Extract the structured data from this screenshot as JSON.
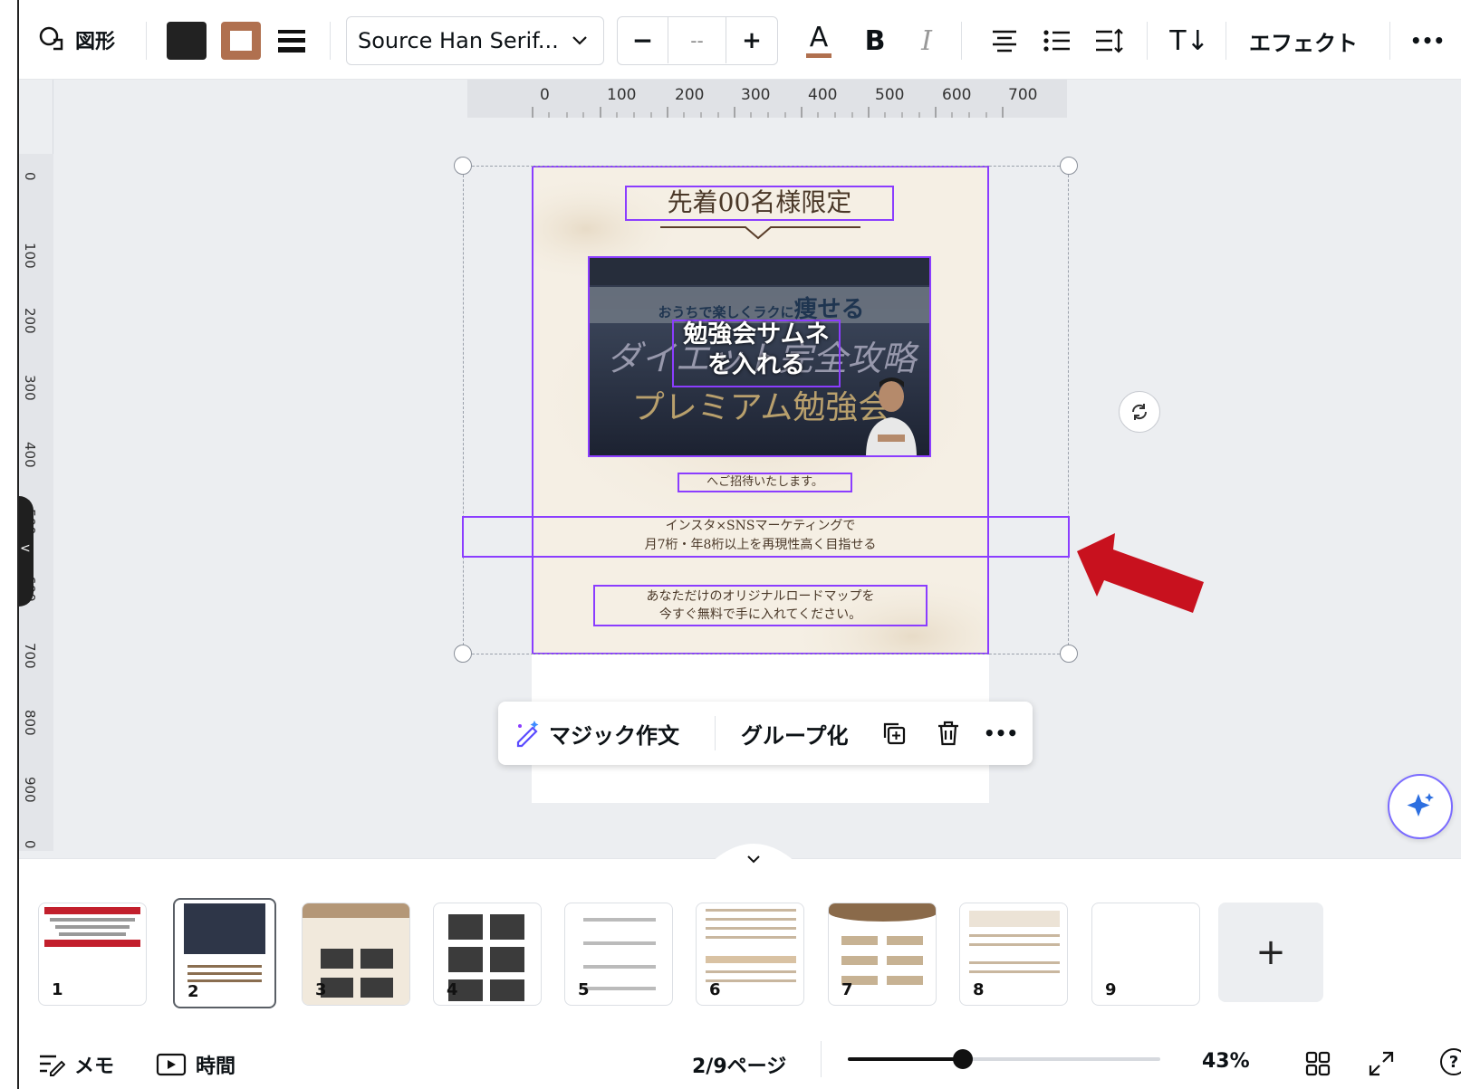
{
  "toolbar": {
    "shape_label": "図形",
    "font_name": "Source Han Serif...",
    "font_size_value": "--",
    "minus": "−",
    "plus": "+",
    "bold": "B",
    "italic": "I",
    "effects_label": "エフェクト",
    "more": "•••",
    "text_color_glyph": "A",
    "text_dir_glyph": "T↓"
  },
  "colors": {
    "fill": "#222222",
    "border": "#b0704f",
    "accent": "#8b3dff",
    "arrow": "#c8111e"
  },
  "ruler": {
    "top": [
      "0",
      "100",
      "200",
      "300",
      "400",
      "500",
      "600",
      "700"
    ],
    "left": [
      "0",
      "100",
      "200",
      "300",
      "400",
      "500",
      "600",
      "700",
      "800",
      "900",
      "0"
    ]
  },
  "page": {
    "heading": "先着00名様限定",
    "image_subtitle_pre": "おうちで楽しくラクに",
    "image_subtitle_em": "痩せる",
    "image_main_line1": "ダイエット完全攻略",
    "image_main_line2": "プレミアム勉強会",
    "image_placeholder_line1": "勉強会サムネ",
    "image_placeholder_line2": "を入れる",
    "invite_text": "へご招待いたします。",
    "selected_line1": "インスタ×SNSマーケティングで",
    "selected_line2": "月7桁・年8桁以上を再現性高く目指せる",
    "cta_line1": "あなただけのオリジナルロードマップを",
    "cta_line2": "今すぐ無料で手に入れてください。"
  },
  "float_bar": {
    "magic_write": "マジック作文",
    "group": "グループ化",
    "more": "•••"
  },
  "pages": [
    "1",
    "2",
    "3",
    "4",
    "5",
    "6",
    "7",
    "8",
    "9"
  ],
  "add_page": "+",
  "status": {
    "notes": "メモ",
    "timer": "時間",
    "page_indicator": "2/9ページ",
    "zoom": "43%",
    "zoom_fraction": 0.43,
    "help": "?"
  }
}
